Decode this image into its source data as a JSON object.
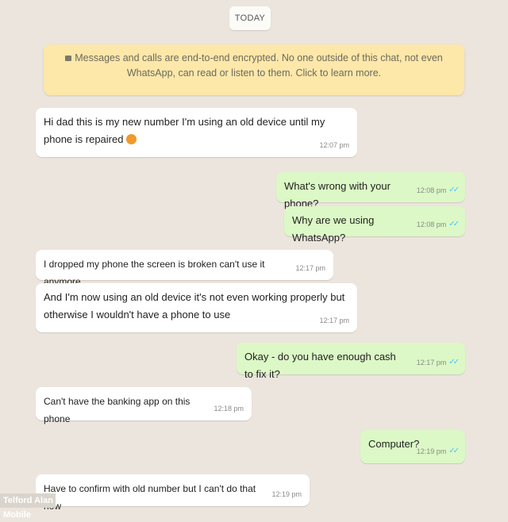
{
  "chat": {
    "date_label": "TODAY",
    "encryption_notice": "Messages and calls are end-to-end encrypted. No one outside of this chat, not even WhatsApp, can read or listen to them. Click to learn more.",
    "messages": [
      {
        "text": "Hi dad this is my new number I'm using an old device until my phone is repaired",
        "time": "12:07 pm",
        "direction": "incoming",
        "emoji": "face-emoji"
      },
      {
        "text": "What's wrong with your phone?",
        "time": "12:08 pm",
        "direction": "outgoing"
      },
      {
        "text": "Why are we using WhatsApp?",
        "time": "12:08 pm",
        "direction": "outgoing"
      },
      {
        "text": "I dropped my phone the screen is broken can't use it anymore",
        "time": "12:17 pm",
        "direction": "incoming"
      },
      {
        "text": "And I'm now using an old device it's not even working properly but otherwise I wouldn't have a phone to use",
        "time": "12:17 pm",
        "direction": "incoming"
      },
      {
        "text": "Okay - do you have enough cash to fix it?",
        "time": "12:17 pm",
        "direction": "outgoing"
      },
      {
        "text": "Can't have the banking app on this phone",
        "time": "12:18 pm",
        "direction": "incoming"
      },
      {
        "text": "Computer?",
        "time": "12:19 pm",
        "direction": "outgoing"
      },
      {
        "text": "Have to confirm with old number but I can't do that now",
        "time": "12:19 pm",
        "direction": "incoming"
      }
    ]
  },
  "watermark": "Telford Alan Mobile",
  "colors": {
    "background": "#ece5dd",
    "incoming_bubble": "#ffffff",
    "outgoing_bubble": "#dcf8c6",
    "notice_bg": "#fde7a9",
    "read_ticks": "#4fc3f7"
  }
}
